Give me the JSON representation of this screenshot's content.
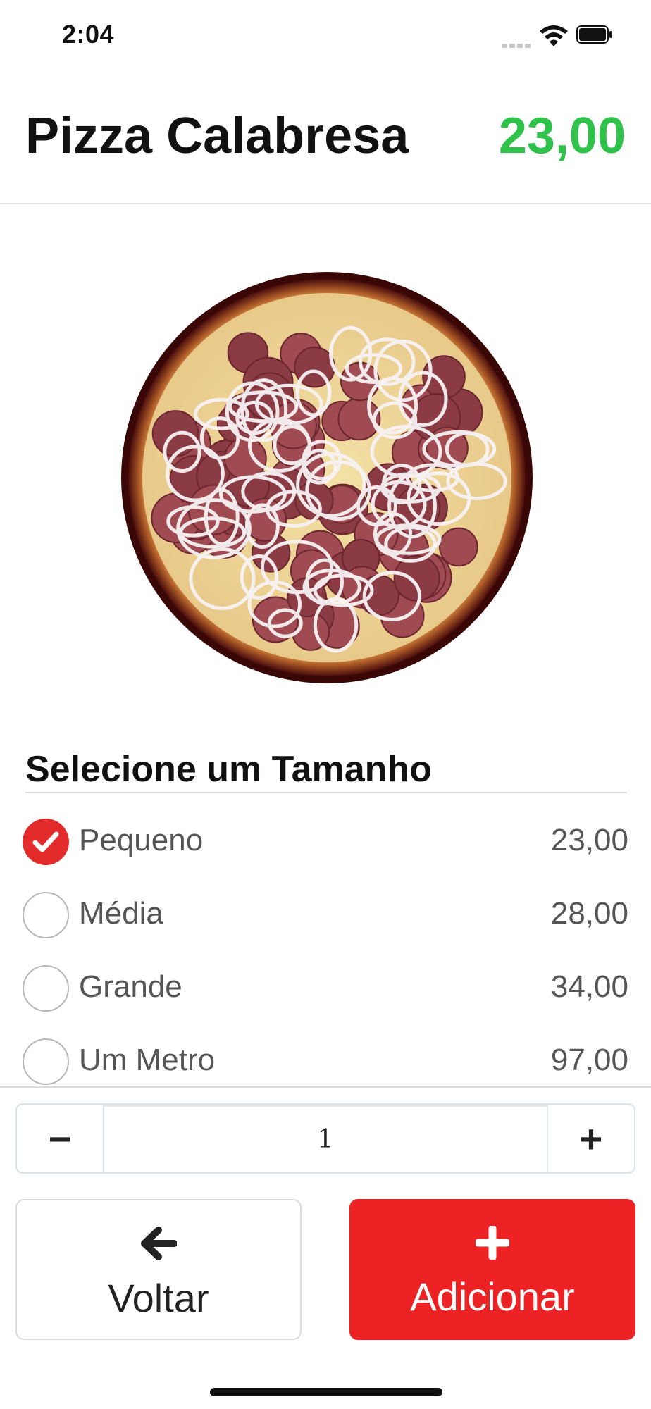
{
  "status_bar": {
    "time": "2:04"
  },
  "product": {
    "name": "Pizza Calabresa",
    "price": "23,00"
  },
  "size_section": {
    "title": "Selecione um Tamanho",
    "options": [
      {
        "label": "Pequeno",
        "price": "23,00",
        "selected": true
      },
      {
        "label": "Média",
        "price": "28,00",
        "selected": false
      },
      {
        "label": "Grande",
        "price": "34,00",
        "selected": false
      },
      {
        "label": "Um Metro",
        "price": "97,00",
        "selected": false
      }
    ]
  },
  "quantity": {
    "value": "1",
    "minus_label": "−",
    "plus_label": "+"
  },
  "actions": {
    "back_label": "Voltar",
    "add_label": "Adicionar"
  },
  "colors": {
    "price_green": "#2fc24a",
    "accent_red": "#ec2224"
  },
  "icons": {
    "back": "arrow-left-icon",
    "add": "plus-icon",
    "selected": "check-icon"
  }
}
